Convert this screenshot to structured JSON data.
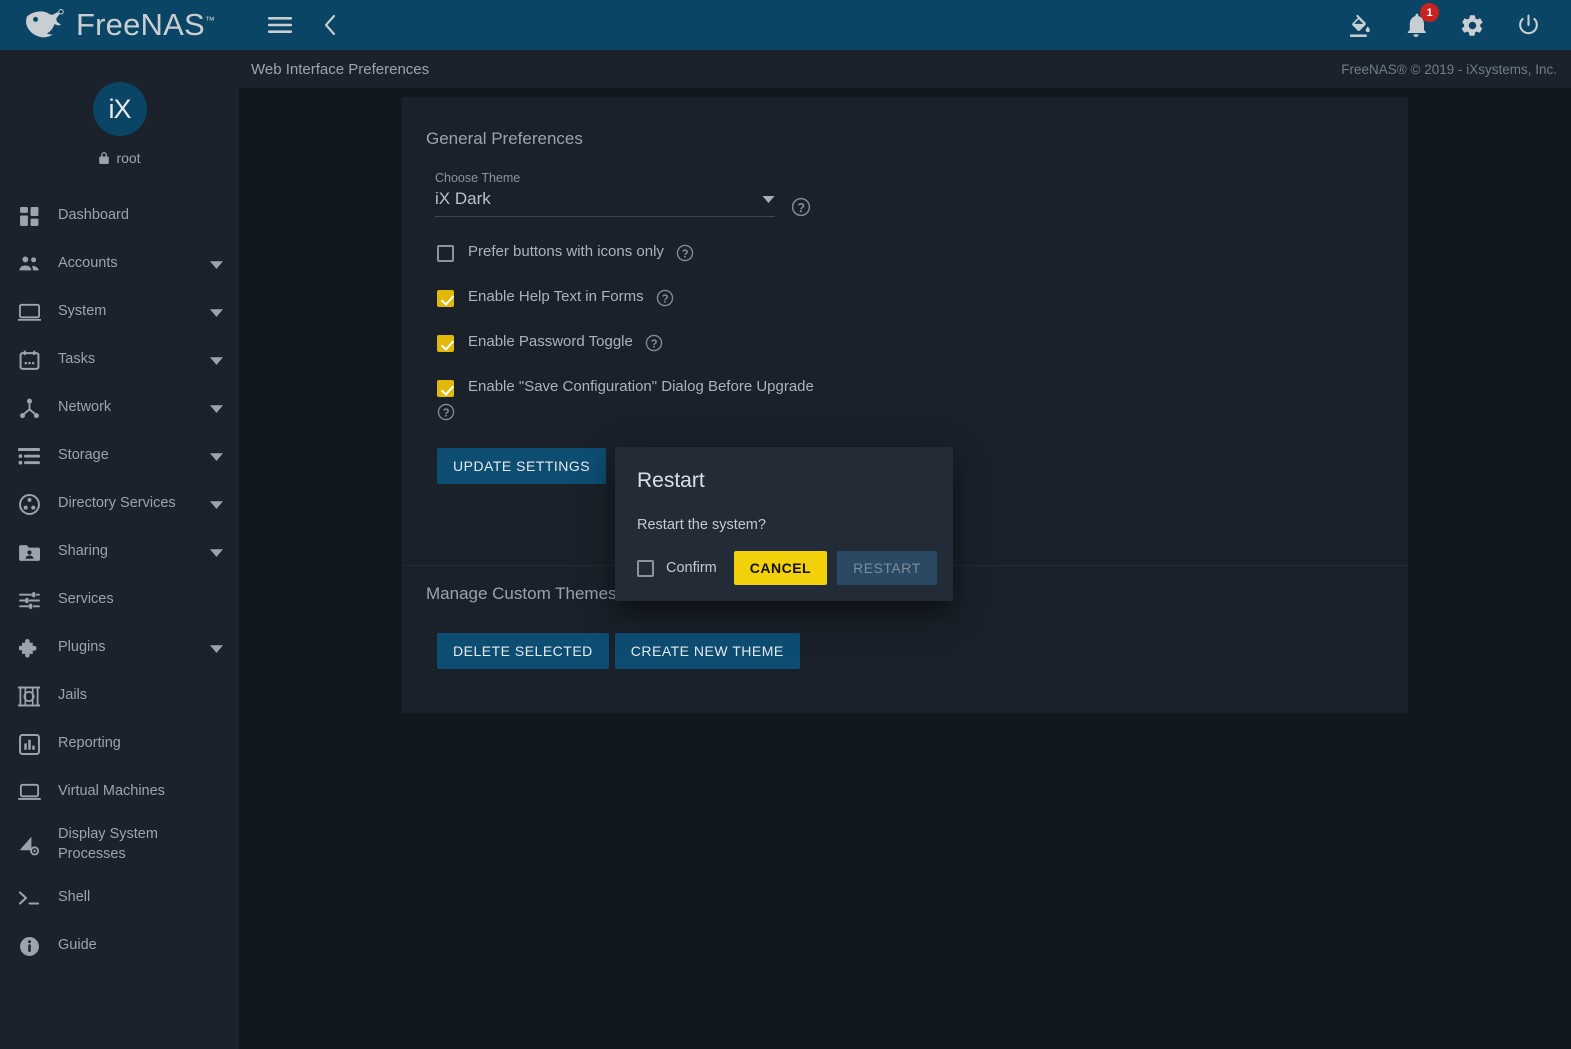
{
  "brand": {
    "name": "FreeNAS",
    "tm": "™"
  },
  "topbar": {
    "menu_icon": "hamburger-icon",
    "back_icon": "chevron-left-icon",
    "theme_icon": "paint-bucket-icon",
    "notifications_icon": "bell-icon",
    "notifications_count": "1",
    "settings_icon": "gear-icon",
    "power_icon": "power-icon"
  },
  "crumbbar": {
    "title": "Web Interface Preferences",
    "copyright": "FreeNAS® © 2019 - iXsystems, Inc."
  },
  "sidebar": {
    "avatar_text": "iX",
    "user": "root",
    "lock_icon": "lock-icon",
    "items": [
      {
        "label": "Dashboard",
        "icon": "dashboard-grid-icon",
        "caret": false
      },
      {
        "label": "Accounts",
        "icon": "people-icon",
        "caret": true
      },
      {
        "label": "System",
        "icon": "monitor-icon",
        "caret": true
      },
      {
        "label": "Tasks",
        "icon": "calendar-icon",
        "caret": true
      },
      {
        "label": "Network",
        "icon": "network-node-icon",
        "caret": true
      },
      {
        "label": "Storage",
        "icon": "storage-list-icon",
        "caret": true
      },
      {
        "label": "Directory Services",
        "icon": "directory-services-icon",
        "caret": true
      },
      {
        "label": "Sharing",
        "icon": "folder-share-icon",
        "caret": true
      },
      {
        "label": "Services",
        "icon": "sliders-icon",
        "caret": false
      },
      {
        "label": "Plugins",
        "icon": "puzzle-piece-icon",
        "caret": true
      },
      {
        "label": "Jails",
        "icon": "jails-icon",
        "caret": false
      },
      {
        "label": "Reporting",
        "icon": "bar-chart-icon",
        "caret": false
      },
      {
        "label": "Virtual Machines",
        "icon": "laptop-icon",
        "caret": false
      },
      {
        "label": "Display System Processes",
        "icon": "processes-icon",
        "caret": false
      },
      {
        "label": "Shell",
        "icon": "terminal-prompt-icon",
        "caret": false
      },
      {
        "label": "Guide",
        "icon": "info-circle-icon",
        "caret": false
      }
    ]
  },
  "main": {
    "general_preferences_title": "General Preferences",
    "theme_field": {
      "label": "Choose Theme",
      "value": "iX Dark",
      "dropdown_icon": "chevron-down-icon",
      "help_icon": "help-circle-icon"
    },
    "checkboxes": [
      {
        "label": "Prefer buttons with icons only",
        "checked": false,
        "help_icon": "help-circle-icon"
      },
      {
        "label": "Enable Help Text in Forms",
        "checked": true,
        "help_icon": "help-circle-icon"
      },
      {
        "label": "Enable Password Toggle",
        "checked": true,
        "help_icon": "help-circle-icon"
      },
      {
        "label": "Enable \"Save Configuration\" Dialog Before Upgrade",
        "checked": true,
        "help_icon": "help-circle-icon"
      }
    ],
    "update_settings_label": "UPDATE SETTINGS",
    "custom_themes_title": "Manage Custom Themes",
    "delete_selected_label": "DELETE SELECTED",
    "create_new_theme_label": "CREATE NEW THEME"
  },
  "modal": {
    "title": "Restart",
    "message": "Restart the system?",
    "confirm_label": "Confirm",
    "confirm_checked": false,
    "cancel_label": "CANCEL",
    "restart_label": "RESTART",
    "restart_disabled": true
  },
  "colors": {
    "header_blue": "#0b4566",
    "panel": "#1b222b",
    "card": "#1a212a",
    "page_bg": "#111820",
    "accent_yellow": "#e0b90b",
    "cancel_yellow": "#f2d00a",
    "button_blue": "#0e4d72",
    "badge_red": "#c9211e"
  }
}
